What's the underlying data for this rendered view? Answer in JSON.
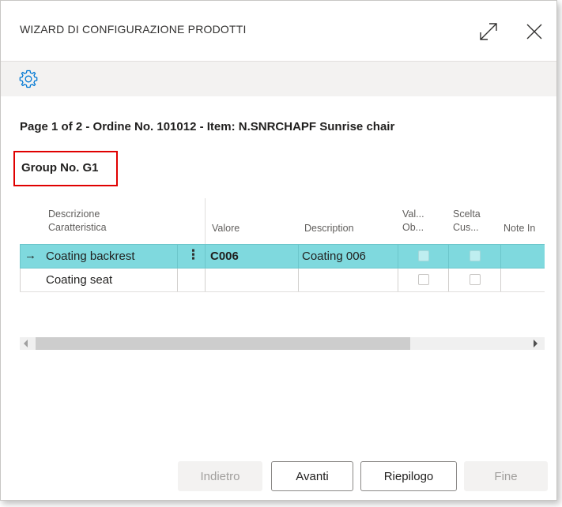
{
  "dialog": {
    "title": "WIZARD DI CONFIGURAZIONE PRODOTTI"
  },
  "page_info": "Page 1 of 2 - Ordine No. 101012 - Item: N.SNRCHAPF Sunrise chair",
  "group_label": "Group No. G1",
  "grid": {
    "headers": {
      "descrizione_1": "Descrizione",
      "descrizione_2": "Caratteristica",
      "valore": "Valore",
      "description": "Description",
      "val_1": "Val...",
      "val_2": "Ob...",
      "scelta_1": "Scelta",
      "scelta_2": "Cus...",
      "note": "Note In"
    },
    "rows": [
      {
        "descrizione": "Coating backrest",
        "valore": "C006",
        "description": "Coating 006",
        "selected": true
      },
      {
        "descrizione": "Coating seat",
        "valore": "",
        "description": "",
        "selected": false
      }
    ],
    "row_actions_glyph": "⋮",
    "row_marker": "→"
  },
  "buttons": {
    "back": "Indietro",
    "next": "Avanti",
    "summary": "Riepilogo",
    "finish": "Fine"
  },
  "colors": {
    "selected_row": "#7fd9de",
    "accent": "#0078d4",
    "highlight_box": "#e00000"
  },
  "icons": {
    "expand": "expand-icon",
    "close": "close-icon",
    "settings": "gear-icon"
  }
}
